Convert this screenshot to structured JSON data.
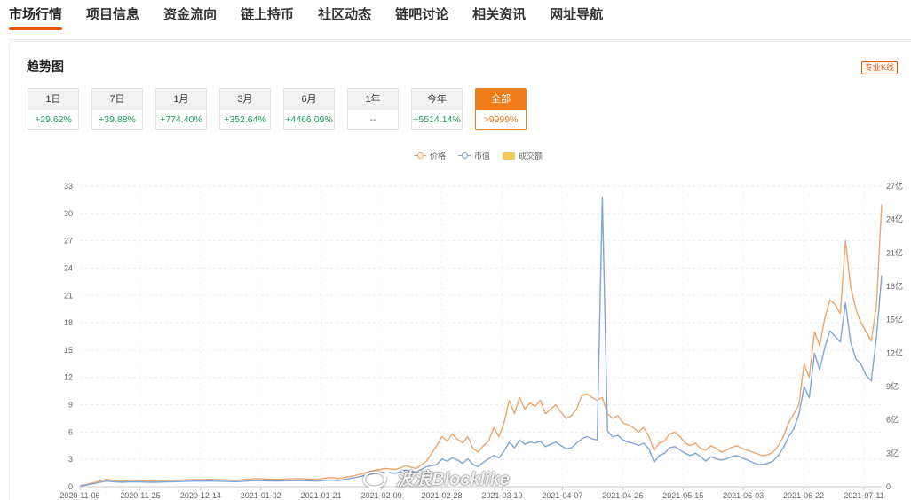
{
  "nav": {
    "tabs": [
      {
        "label": "市场行情",
        "active": true
      },
      {
        "label": "项目信息"
      },
      {
        "label": "资金流向"
      },
      {
        "label": "链上持币"
      },
      {
        "label": "社区动态"
      },
      {
        "label": "链吧讨论"
      },
      {
        "label": "相关资讯"
      },
      {
        "label": "网址导航"
      }
    ]
  },
  "card": {
    "title": "趋势图",
    "kline_badge": "专业K线"
  },
  "periods": [
    {
      "label": "1日",
      "change": "+29.62%"
    },
    {
      "label": "7日",
      "change": "+39.88%"
    },
    {
      "label": "1月",
      "change": "+774.40%"
    },
    {
      "label": "3月",
      "change": "+352.64%"
    },
    {
      "label": "6月",
      "change": "+4466.09%"
    },
    {
      "label": "1年",
      "change": "--"
    },
    {
      "label": "今年",
      "change": "+5514.14%"
    },
    {
      "label": "全部",
      "change": ">9999%",
      "active": true
    }
  ],
  "watermark": "波浪Blocklike",
  "colors": {
    "accent": "#f07b19",
    "up": "#1aa35c",
    "price": "#f0a56b",
    "market_cap": "#7fa6d8",
    "volume": "#f5c85a"
  },
  "chart_data": {
    "type": "line",
    "legend": [
      {
        "name": "价格",
        "color": "#f0a56b",
        "kind": "line"
      },
      {
        "name": "市值",
        "color": "#7fa6d8",
        "kind": "line"
      },
      {
        "name": "成交额",
        "color": "#f5c85a",
        "kind": "bar"
      }
    ],
    "x_labels": [
      "2020-11-06",
      "2020-11-25",
      "2020-12-14",
      "2021-01-02",
      "2021-01-21",
      "2021-02-09",
      "2021-02-28",
      "2021-03-19",
      "2021-04-07",
      "2021-04-26",
      "2021-05-15",
      "2021-06-03",
      "2021-06-22",
      "2021-07-11"
    ],
    "y_left": {
      "ticks": [
        "0",
        "3",
        "6",
        "9",
        "12",
        "15",
        "18",
        "21",
        "24",
        "27",
        "30",
        "33"
      ],
      "min": 0,
      "max": 33
    },
    "y_right": {
      "ticks": [
        "0",
        "3亿",
        "6亿",
        "9亿",
        "12亿",
        "15亿",
        "18亿",
        "21亿",
        "24亿",
        "27亿"
      ],
      "min": 0,
      "max": 27
    },
    "series": [
      {
        "name": "价格",
        "axis": "left",
        "color": "#f0a56b",
        "points": [
          [
            0,
            0.1
          ],
          [
            3,
            0.5
          ],
          [
            5,
            0.8
          ],
          [
            8,
            0.6
          ],
          [
            10,
            0.7
          ],
          [
            14,
            0.6
          ],
          [
            18,
            0.7
          ],
          [
            22,
            0.8
          ],
          [
            26,
            0.8
          ],
          [
            30,
            0.7
          ],
          [
            34,
            0.9
          ],
          [
            38,
            0.8
          ],
          [
            42,
            0.9
          ],
          [
            46,
            0.8
          ],
          [
            48,
            1.0
          ],
          [
            50,
            0.9
          ],
          [
            53,
            1.2
          ],
          [
            55,
            1.5
          ],
          [
            57,
            1.8
          ],
          [
            59,
            2.0
          ],
          [
            61,
            1.9
          ],
          [
            63,
            2.3
          ],
          [
            65,
            2.0
          ],
          [
            67,
            2.8
          ],
          [
            69,
            4.5
          ],
          [
            70,
            5.5
          ],
          [
            71,
            5.0
          ],
          [
            72,
            5.8
          ],
          [
            73,
            5.2
          ],
          [
            74,
            4.8
          ],
          [
            75,
            5.5
          ],
          [
            76,
            4.2
          ],
          [
            77,
            3.8
          ],
          [
            78,
            4.5
          ],
          [
            79,
            5.0
          ],
          [
            80,
            6.5
          ],
          [
            81,
            5.5
          ],
          [
            82,
            7.0
          ],
          [
            83,
            9.5
          ],
          [
            84,
            8.0
          ],
          [
            85,
            9.8
          ],
          [
            86,
            8.5
          ],
          [
            87,
            9.2
          ],
          [
            88,
            8.8
          ],
          [
            89,
            9.5
          ],
          [
            90,
            8.0
          ],
          [
            91,
            8.5
          ],
          [
            92,
            9.0
          ],
          [
            93,
            8.2
          ],
          [
            94,
            7.5
          ],
          [
            95,
            7.8
          ],
          [
            96,
            8.5
          ],
          [
            97,
            10.0
          ],
          [
            98,
            10.2
          ],
          [
            99,
            9.8
          ],
          [
            100,
            9.5
          ],
          [
            101,
            9.8
          ],
          [
            102,
            8.0
          ],
          [
            103,
            7.5
          ],
          [
            104,
            7.8
          ],
          [
            105,
            7.0
          ],
          [
            106,
            6.8
          ],
          [
            107,
            6.5
          ],
          [
            108,
            6.0
          ],
          [
            109,
            6.5
          ],
          [
            110,
            5.5
          ],
          [
            111,
            4.0
          ],
          [
            112,
            4.8
          ],
          [
            113,
            5.0
          ],
          [
            114,
            5.8
          ],
          [
            115,
            6.0
          ],
          [
            116,
            5.5
          ],
          [
            117,
            4.8
          ],
          [
            118,
            4.5
          ],
          [
            119,
            4.8
          ],
          [
            120,
            4.2
          ],
          [
            121,
            4.0
          ],
          [
            122,
            4.5
          ],
          [
            123,
            4.2
          ],
          [
            124,
            3.8
          ],
          [
            125,
            4.0
          ],
          [
            126,
            4.3
          ],
          [
            127,
            4.5
          ],
          [
            128,
            4.2
          ],
          [
            129,
            4.0
          ],
          [
            130,
            3.8
          ],
          [
            131,
            3.6
          ],
          [
            132,
            3.4
          ],
          [
            133,
            3.5
          ],
          [
            134,
            3.8
          ],
          [
            135,
            4.5
          ],
          [
            136,
            5.5
          ],
          [
            137,
            7.0
          ],
          [
            138,
            8.0
          ],
          [
            139,
            9.0
          ],
          [
            140,
            13.5
          ],
          [
            141,
            12.0
          ],
          [
            142,
            17.0
          ],
          [
            143,
            15.5
          ],
          [
            144,
            18.5
          ],
          [
            145,
            20.5
          ],
          [
            146,
            20.0
          ],
          [
            147,
            19.0
          ],
          [
            148,
            27.0
          ],
          [
            149,
            22.0
          ],
          [
            150,
            19.5
          ],
          [
            151,
            18.0
          ],
          [
            152,
            17.0
          ],
          [
            153,
            16.0
          ],
          [
            154,
            20.0
          ],
          [
            155,
            31.0
          ]
        ]
      },
      {
        "name": "市值",
        "axis": "right",
        "color": "#7fa6d8",
        "points": [
          [
            0,
            0.05
          ],
          [
            3,
            0.3
          ],
          [
            5,
            0.5
          ],
          [
            8,
            0.4
          ],
          [
            10,
            0.45
          ],
          [
            14,
            0.4
          ],
          [
            18,
            0.45
          ],
          [
            22,
            0.5
          ],
          [
            26,
            0.5
          ],
          [
            30,
            0.45
          ],
          [
            34,
            0.55
          ],
          [
            38,
            0.5
          ],
          [
            42,
            0.55
          ],
          [
            46,
            0.5
          ],
          [
            48,
            0.6
          ],
          [
            50,
            0.55
          ],
          [
            53,
            0.8
          ],
          [
            55,
            1.0
          ],
          [
            57,
            1.2
          ],
          [
            59,
            1.3
          ],
          [
            61,
            1.2
          ],
          [
            63,
            1.5
          ],
          [
            65,
            1.3
          ],
          [
            67,
            1.8
          ],
          [
            69,
            2.0
          ],
          [
            70,
            2.5
          ],
          [
            71,
            2.3
          ],
          [
            72,
            2.6
          ],
          [
            73,
            2.4
          ],
          [
            74,
            2.1
          ],
          [
            75,
            2.5
          ],
          [
            76,
            2.0
          ],
          [
            77,
            1.8
          ],
          [
            78,
            2.2
          ],
          [
            79,
            2.5
          ],
          [
            80,
            2.8
          ],
          [
            81,
            2.6
          ],
          [
            82,
            3.2
          ],
          [
            83,
            4.0
          ],
          [
            84,
            3.5
          ],
          [
            85,
            4.2
          ],
          [
            86,
            3.8
          ],
          [
            87,
            4.0
          ],
          [
            88,
            3.9
          ],
          [
            89,
            4.1
          ],
          [
            90,
            3.6
          ],
          [
            91,
            3.8
          ],
          [
            92,
            4.0
          ],
          [
            93,
            3.7
          ],
          [
            94,
            3.4
          ],
          [
            95,
            3.5
          ],
          [
            96,
            3.9
          ],
          [
            97,
            4.3
          ],
          [
            98,
            4.5
          ],
          [
            99,
            4.3
          ],
          [
            100,
            4.2
          ],
          [
            101,
            26.0
          ],
          [
            102,
            5.0
          ],
          [
            103,
            4.5
          ],
          [
            104,
            4.6
          ],
          [
            105,
            4.2
          ],
          [
            106,
            4.0
          ],
          [
            107,
            3.9
          ],
          [
            108,
            3.7
          ],
          [
            109,
            3.9
          ],
          [
            110,
            3.4
          ],
          [
            111,
            2.2
          ],
          [
            112,
            2.8
          ],
          [
            113,
            3.0
          ],
          [
            114,
            3.5
          ],
          [
            115,
            3.6
          ],
          [
            116,
            3.3
          ],
          [
            117,
            3.0
          ],
          [
            118,
            2.8
          ],
          [
            119,
            3.0
          ],
          [
            120,
            2.7
          ],
          [
            121,
            2.3
          ],
          [
            122,
            2.7
          ],
          [
            123,
            2.5
          ],
          [
            124,
            2.4
          ],
          [
            125,
            2.5
          ],
          [
            126,
            2.7
          ],
          [
            127,
            2.8
          ],
          [
            128,
            2.6
          ],
          [
            129,
            2.4
          ],
          [
            130,
            2.2
          ],
          [
            131,
            2.0
          ],
          [
            132,
            2.0
          ],
          [
            133,
            2.1
          ],
          [
            134,
            2.3
          ],
          [
            135,
            2.8
          ],
          [
            136,
            3.5
          ],
          [
            137,
            4.5
          ],
          [
            138,
            5.2
          ],
          [
            139,
            6.5
          ],
          [
            140,
            9.0
          ],
          [
            141,
            8.0
          ],
          [
            142,
            12.0
          ],
          [
            143,
            10.5
          ],
          [
            144,
            12.5
          ],
          [
            145,
            14.0
          ],
          [
            146,
            13.5
          ],
          [
            147,
            13.0
          ],
          [
            148,
            16.5
          ],
          [
            149,
            13.0
          ],
          [
            150,
            11.5
          ],
          [
            151,
            11.0
          ],
          [
            152,
            10.0
          ],
          [
            153,
            9.5
          ],
          [
            154,
            13.5
          ],
          [
            155,
            19.0
          ]
        ]
      }
    ]
  }
}
